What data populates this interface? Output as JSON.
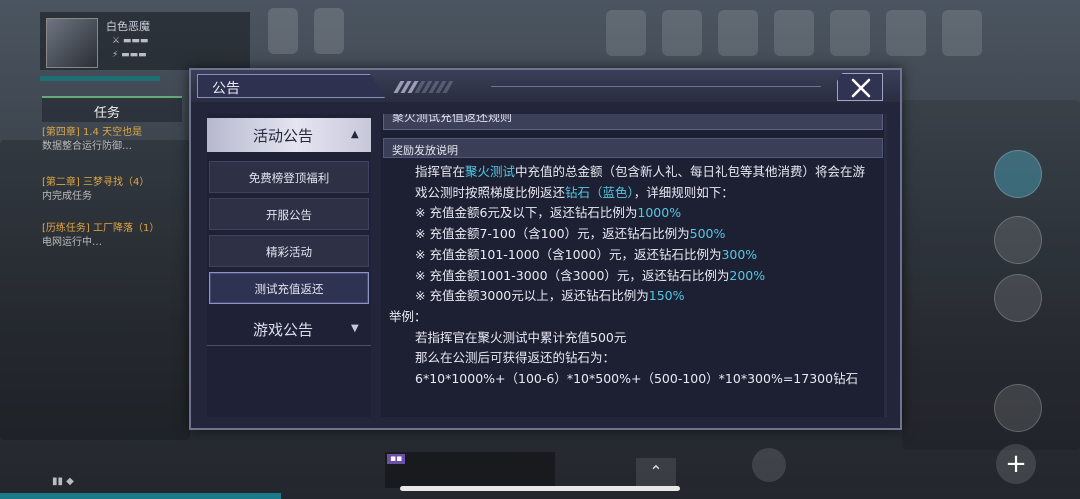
{
  "dialog": {
    "title": "公告",
    "close_icon": "close-x-icon"
  },
  "menu": {
    "categories": [
      {
        "label": "活动公告",
        "expanded": true,
        "arrow": "▲",
        "items": [
          "免费榜登顶福利",
          "开服公告",
          "精彩活动",
          "测试充值返还"
        ],
        "selected": "测试充值返还"
      },
      {
        "label": "游戏公告",
        "expanded": false,
        "arrow": "▼"
      }
    ]
  },
  "article": {
    "title": "聚火测试充值返还规则",
    "section": "奖励发放说明",
    "intro": {
      "a": "指挥官在",
      "b": "聚火测试",
      "c": "中充值的总金额（包含新人礼、每日礼包等其他消费）将会在游戏公测时按照梯度比例返还",
      "d": "钻石（蓝色）",
      "e": "，详细规则如下："
    },
    "rules": [
      {
        "text": "※ 充值金额6元及以下，返还钻石比例为",
        "rate": "1000%"
      },
      {
        "text": "※ 充值金额7-100（含100）元，返还钻石比例为",
        "rate": "500%"
      },
      {
        "text": "※ 充值金额101-1000（含1000）元，返还钻石比例为",
        "rate": "300%"
      },
      {
        "text": "※ 充值金额1001-3000（含3000）元，返还钻石比例为",
        "rate": "200%"
      },
      {
        "text": "※ 充值金额3000元以上，返还钻石比例为",
        "rate": "150%"
      }
    ],
    "example_label": "举例：",
    "example_lines": [
      "若指挥官在聚火测试中累计充值500元",
      "那么在公测后可获得返还的钻石为：",
      "6*10*1000%+（100-6）*10*500%+（500-100）*10*300%=17300钻石"
    ]
  },
  "hud": {
    "player_name": "白色恶魔",
    "task_tab": "任务",
    "task_items": [
      {
        "title": "[第四章] 1.4 天空也是",
        "desc": "数据整合运行防御…"
      },
      {
        "title": "[第二章] 三梦寻找（4）",
        "desc": "内完成任务"
      },
      {
        "title": "[历练任务] 工厂降落（1）",
        "desc": "电网运行中…"
      }
    ],
    "accent_color": "#53c7e2"
  }
}
